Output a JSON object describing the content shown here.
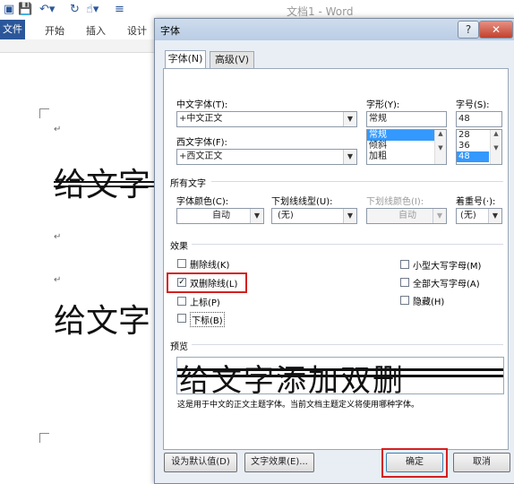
{
  "word": {
    "title": "文档1 - Word",
    "ribbon_tabs": [
      "文件",
      "开始",
      "插入",
      "设计"
    ],
    "doc_lines": [
      "给文字",
      "给文字"
    ]
  },
  "dialog": {
    "title": "字体",
    "help": "?",
    "close": "✕",
    "tabs": [
      "字体(N)",
      "高级(V)"
    ],
    "chinese_font_label": "中文字体(T):",
    "chinese_font_value": "+中文正文",
    "western_font_label": "西文字体(F):",
    "western_font_value": "+西文正文",
    "style_label": "字形(Y):",
    "style_value": "常规",
    "style_options": [
      "常规",
      "倾斜",
      "加粗"
    ],
    "size_label": "字号(S):",
    "size_value": "48",
    "size_options": [
      "28",
      "36",
      "48"
    ],
    "all_text_heading": "所有文字",
    "font_color_label": "字体颜色(C):",
    "font_color_value": "自动",
    "underline_style_label": "下划线线型(U):",
    "underline_style_value": "(无)",
    "underline_color_label": "下划线颜色(I):",
    "underline_color_value": "自动",
    "emphasis_label": "着重号(·):",
    "emphasis_value": "(无)",
    "effects_heading": "效果",
    "effects_left": [
      {
        "label": "删除线(K)",
        "checked": false
      },
      {
        "label": "双删除线(L)",
        "checked": true
      },
      {
        "label": "上标(P)",
        "checked": false
      },
      {
        "label": "下标(B)",
        "checked": false
      }
    ],
    "effects_right": [
      {
        "label": "小型大写字母(M)",
        "checked": false
      },
      {
        "label": "全部大写字母(A)",
        "checked": false
      },
      {
        "label": "隐藏(H)",
        "checked": false
      }
    ],
    "preview_heading": "预览",
    "preview_text": "给文字添加双删",
    "preview_note": "这是用于中文的正文主题字体。当前文档主题定义将使用哪种字体。",
    "buttons": {
      "set_default": "设为默认值(D)",
      "text_effects": "文字效果(E)...",
      "ok": "确定",
      "cancel": "取消"
    },
    "highlight_color": "#d42020"
  }
}
